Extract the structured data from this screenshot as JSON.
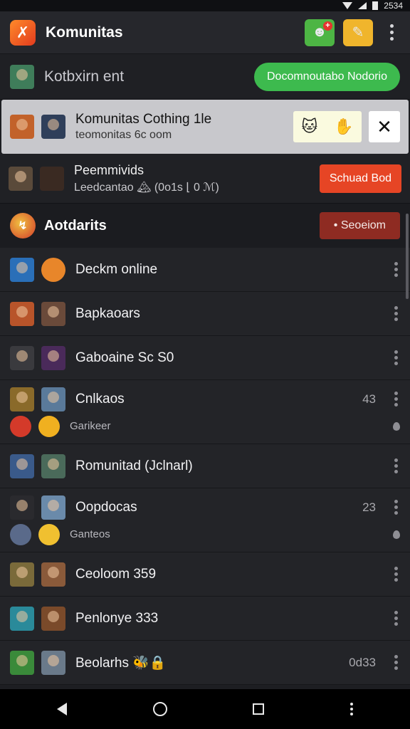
{
  "status_bar": {
    "time": "2534"
  },
  "app_bar": {
    "logo_glyph": "✗",
    "title": "Komunitas",
    "green_icon": "☻",
    "green_badge": "+",
    "yellow_icon": "✎"
  },
  "account": {
    "name": "Kotbxirn ent",
    "button": "Docomnoutabo Nodorio"
  },
  "highlight": {
    "title": "Komunitas Cothing 1le",
    "subtitle": "teomonitas 6c oom",
    "react1": "🐱",
    "react2": "✋",
    "close": "✕"
  },
  "peer": {
    "title": "Peemmivids",
    "subtitle": "Leedcantao 🏔 (0o1s ⌊ 0 ℳ)",
    "button": "Schuad Bod"
  },
  "section": {
    "icon_glyph": "↯",
    "title": "Aotdarits",
    "button": "• Seoeiom"
  },
  "list": [
    {
      "label": "Deckm online",
      "count": "",
      "sub": "",
      "colors": [
        "#2a6fb8",
        "#e8862a"
      ]
    },
    {
      "label": "Bapkaoars",
      "count": "",
      "sub": "",
      "colors": [
        "#b8542a",
        "#6a4a3a"
      ]
    },
    {
      "label": "Gaboaine Sc S0",
      "count": "",
      "sub": "",
      "colors": [
        "#3a3a3e",
        "#4a2a5a"
      ]
    },
    {
      "label": "Cnlkaos",
      "count": "43",
      "sub": "Garikeer",
      "colors": [
        "#8a6a2a",
        "#5a7a9a"
      ],
      "sub_colors": [
        "#d43a2a",
        "#f0b020"
      ]
    },
    {
      "label": "Romunitad (Jclnarl)",
      "count": "",
      "sub": "",
      "colors": [
        "#3a5a8a",
        "#4a6a5a"
      ]
    },
    {
      "label": "Oopdocas",
      "count": "23",
      "sub": "Ganteos",
      "colors": [
        "#2a2a2e",
        "#6a8aaa"
      ],
      "sub_colors": [
        "#5a6a8a",
        "#f0c030"
      ]
    },
    {
      "label": "Ceoloom 359",
      "count": "",
      "sub": "",
      "colors": [
        "#7a6a3a",
        "#8a5a3a"
      ]
    },
    {
      "label": "Penlonye 333",
      "count": "",
      "sub": "",
      "colors": [
        "#2a8a9a",
        "#7a4a2a"
      ]
    },
    {
      "label": "Beolarhs 🐝🔒",
      "count": "0d33",
      "sub": "",
      "colors": [
        "#3a8a3a",
        "#6a7a8a"
      ]
    }
  ]
}
